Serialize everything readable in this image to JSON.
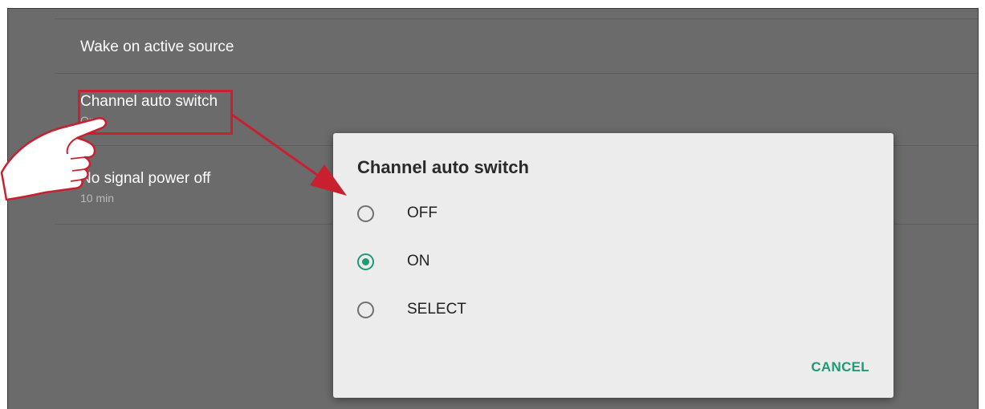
{
  "settings": {
    "items": [
      {
        "title": "Wake on active source",
        "subtitle": ""
      },
      {
        "title": "Channel auto switch",
        "subtitle": "On"
      },
      {
        "title": "No signal power off",
        "subtitle": "10 min"
      }
    ]
  },
  "dialog": {
    "title": "Channel auto switch",
    "options": [
      {
        "label": "OFF",
        "selected": false
      },
      {
        "label": "ON",
        "selected": true
      },
      {
        "label": "SELECT",
        "selected": false
      }
    ],
    "cancel_label": "CANCEL"
  },
  "colors": {
    "accent": "#1e9a78",
    "annotation": "#c8202f",
    "backdrop": "#6a6b6a",
    "dialog_bg": "#ececec"
  },
  "icons": {
    "annotation_pointer": "pointing-hand-icon",
    "annotation_arrow": "arrow-icon"
  }
}
